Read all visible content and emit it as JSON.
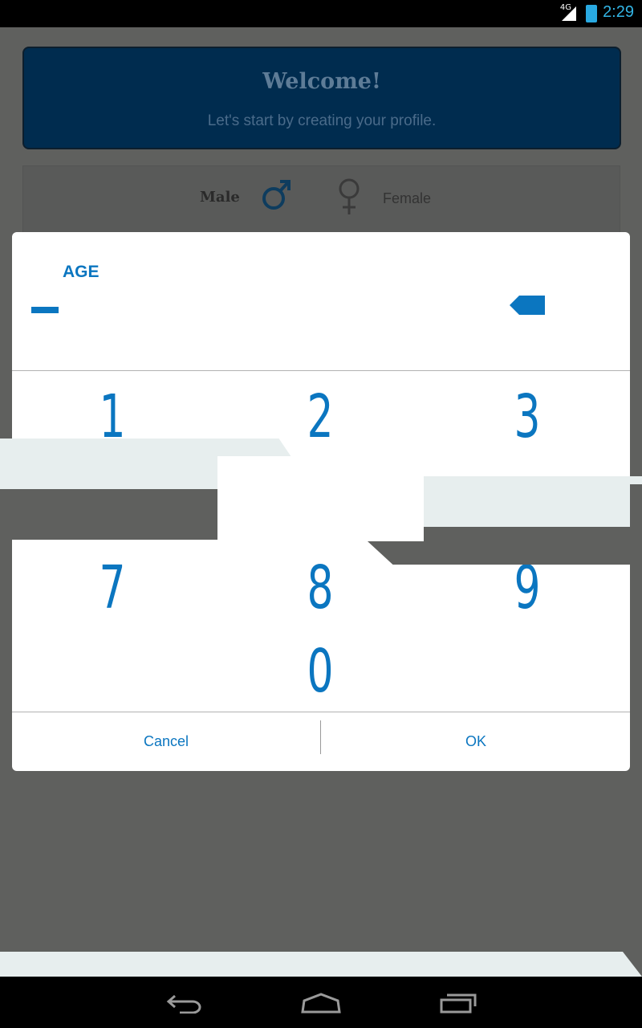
{
  "status_bar": {
    "network": "4G",
    "time": "2:29",
    "accent_color": "#33b5e5"
  },
  "profile": {
    "welcome_title": "Welcome!",
    "welcome_subtitle": "Let's start by creating your profile.",
    "male_label": "Male",
    "female_label": "Female",
    "male_icon": "male-symbol-icon",
    "female_icon": "female-symbol-icon"
  },
  "dialog": {
    "title": "AGE",
    "keys": [
      "1",
      "2",
      "3",
      "7",
      "8",
      "9",
      "0"
    ],
    "cancel_label": "Cancel",
    "ok_label": "OK",
    "accent_color": "#0b76c0"
  },
  "nav_bar": {
    "icons": [
      "back-icon",
      "home-icon",
      "recent-apps-icon"
    ]
  }
}
